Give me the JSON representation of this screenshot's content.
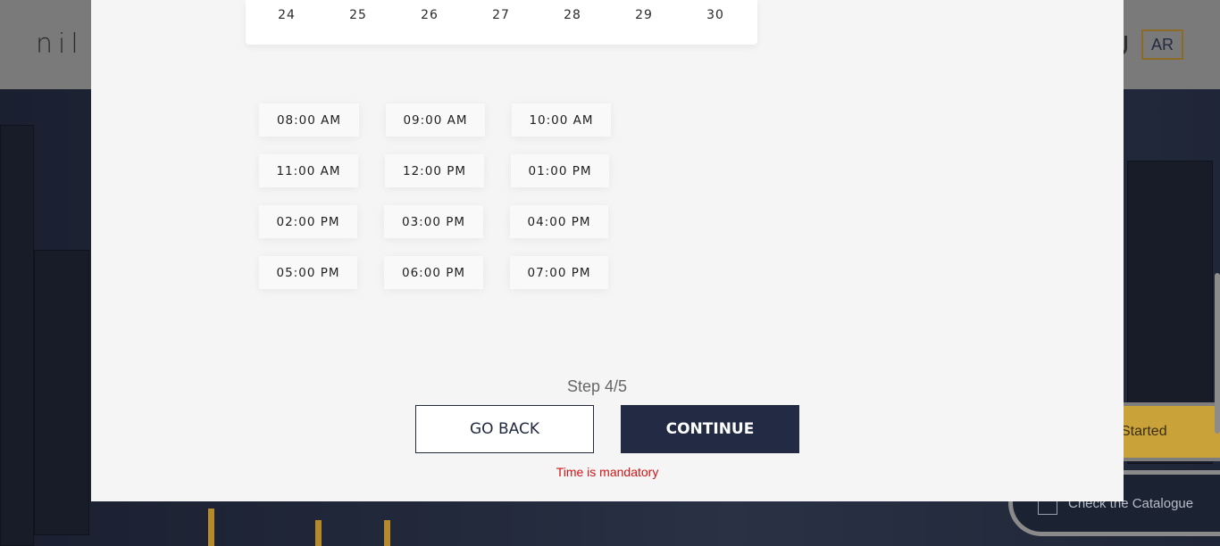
{
  "header": {
    "logo_text": "nil",
    "language_button": "AR"
  },
  "floating": {
    "get_started_label": "Started",
    "catalogue_label": "Check the Catalogue"
  },
  "calendar": {
    "days": [
      "24",
      "25",
      "26",
      "27",
      "28",
      "29",
      "30"
    ]
  },
  "time_slots": [
    "08:00 AM",
    "09:00 AM",
    "10:00 AM",
    "11:00 AM",
    "12:00 PM",
    "01:00 PM",
    "02:00 PM",
    "03:00 PM",
    "04:00 PM",
    "05:00 PM",
    "06:00 PM",
    "07:00 PM"
  ],
  "footer": {
    "step": "Step 4/5",
    "back_label": "GO BACK",
    "continue_label": "CONTINUE",
    "error": "Time is mandatory"
  },
  "colors": {
    "primary": "#222a44",
    "accent_gold": "#c9a23a",
    "error": "#d01616"
  }
}
